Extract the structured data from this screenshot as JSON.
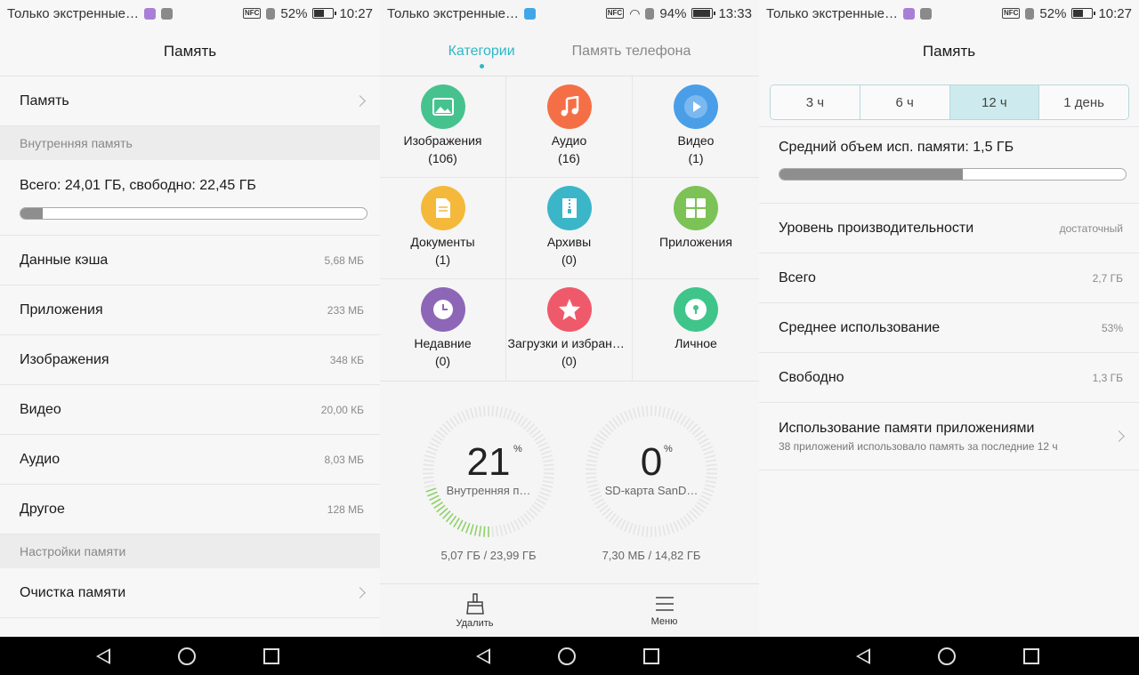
{
  "colors": {
    "accent": "#2fb7c5",
    "gauge_green": "#8fd16a"
  },
  "panel1": {
    "status": {
      "left": "Только экстренные…",
      "battery": "52%",
      "time": "10:27"
    },
    "title": "Память",
    "memory_row": "Память",
    "internal_section": "Внутренняя память",
    "total_text": "Всего: 24,01 ГБ, свободно: 22,45 ГБ",
    "used_fraction": 0.065,
    "items": [
      {
        "label": "Данные кэша",
        "value": "5,68 МБ"
      },
      {
        "label": "Приложения",
        "value": "233 МБ"
      },
      {
        "label": "Изображения",
        "value": "348 КБ"
      },
      {
        "label": "Видео",
        "value": "20,00 КБ"
      },
      {
        "label": "Аудио",
        "value": "8,03 МБ"
      },
      {
        "label": "Другое",
        "value": "128 МБ"
      }
    ],
    "settings_section": "Настройки памяти",
    "cleanup_row": "Очистка памяти"
  },
  "panel2": {
    "status": {
      "left": "Только экстренные…",
      "battery": "94%",
      "time": "13:33"
    },
    "tabs": [
      "Категории",
      "Память телефона"
    ],
    "categories": [
      {
        "label": "Изображения",
        "count": "(106)",
        "color": "#46c28e",
        "icon": "image-icon"
      },
      {
        "label": "Аудио",
        "count": "(16)",
        "color": "#f56f46",
        "icon": "music-icon"
      },
      {
        "label": "Видео",
        "count": "(1)",
        "color": "#4a9ee8",
        "icon": "play-icon"
      },
      {
        "label": "Документы",
        "count": "(1)",
        "color": "#f4b93a",
        "icon": "document-icon"
      },
      {
        "label": "Архивы",
        "count": "(0)",
        "color": "#3bb6c9",
        "icon": "archive-icon"
      },
      {
        "label": "Приложения",
        "count": "",
        "color": "#7cc257",
        "icon": "apps-icon"
      },
      {
        "label": "Недавние",
        "count": "(0)",
        "color": "#8e66b8",
        "icon": "clock-icon"
      },
      {
        "label": "Загрузки и избранн…",
        "count": "(0)",
        "color": "#ef5a6b",
        "icon": "star-icon"
      },
      {
        "label": "Личное",
        "count": "",
        "color": "#3fc58a",
        "icon": "lock-icon"
      }
    ],
    "gauges": [
      {
        "value": "21",
        "unit": "%",
        "label": "Внутренняя п…",
        "size": "5,07 ГБ / 23,99 ГБ",
        "fraction": 0.21
      },
      {
        "value": "0",
        "unit": "%",
        "label": "SD-карта SanD…",
        "size": "7,30 МБ / 14,82 ГБ",
        "fraction": 0.0
      }
    ],
    "bottom": {
      "delete": "Удалить",
      "menu": "Меню"
    }
  },
  "panel3": {
    "status": {
      "left": "Только экстренные…",
      "battery": "52%",
      "time": "10:27"
    },
    "title": "Память",
    "segments": [
      "3 ч",
      "6 ч",
      "12 ч",
      "1 день"
    ],
    "selected_segment": 2,
    "avg_text": "Средний объем исп. памяти: 1,5 ГБ",
    "avg_fraction": 0.53,
    "rows": [
      {
        "label": "Уровень производительности",
        "value": "достаточный"
      },
      {
        "label": "Всего",
        "value": "2,7 ГБ"
      },
      {
        "label": "Среднее использование",
        "value": "53%"
      },
      {
        "label": "Свободно",
        "value": "1,3 ГБ"
      }
    ],
    "app_usage": {
      "title": "Использование памяти приложениями",
      "subtitle": "38 приложений использовало память за последние 12 ч"
    }
  }
}
